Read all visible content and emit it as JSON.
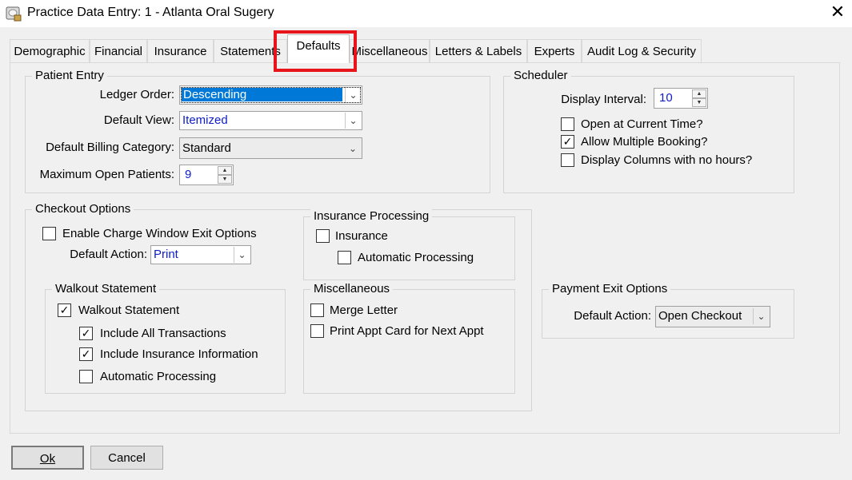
{
  "window": {
    "title": "Practice Data Entry: 1 - Atlanta Oral Sugery",
    "close_glyph": "✕"
  },
  "tabs": [
    {
      "label": "Demographic"
    },
    {
      "label": "Financial"
    },
    {
      "label": "Insurance"
    },
    {
      "label": "Statements"
    },
    {
      "label": "Defaults"
    },
    {
      "label": "Miscellaneous"
    },
    {
      "label": "Letters & Labels"
    },
    {
      "label": "Experts"
    },
    {
      "label": "Audit Log & Security"
    }
  ],
  "active_tab": "Defaults",
  "highlight_color": "#e8141b",
  "patient_entry": {
    "legend": "Patient Entry",
    "ledger_order_label": "Ledger Order:",
    "ledger_order_value": "Descending",
    "default_view_label": "Default View:",
    "default_view_value": "Itemized",
    "billing_category_label": "Default Billing Category:",
    "billing_category_value": "Standard",
    "max_open_label": "Maximum Open Patients:",
    "max_open_value": "9"
  },
  "scheduler": {
    "legend": "Scheduler",
    "display_interval_label": "Display Interval:",
    "display_interval_value": "10",
    "open_current_time": {
      "label": "Open at Current Time?",
      "checked": false
    },
    "allow_multiple": {
      "label": "Allow Multiple Booking?",
      "checked": true
    },
    "display_columns": {
      "label": "Display Columns with no hours?",
      "checked": false
    }
  },
  "checkout": {
    "legend": "Checkout Options",
    "enable_exit": {
      "label": "Enable Charge Window Exit Options",
      "checked": false
    },
    "default_action_label": "Default Action:",
    "default_action_value": "Print",
    "walkout": {
      "legend": "Walkout Statement",
      "walkout_statement": {
        "label": "Walkout Statement",
        "checked": true
      },
      "include_all": {
        "label": "Include All Transactions",
        "checked": true
      },
      "include_insurance": {
        "label": "Include Insurance Information",
        "checked": true
      },
      "automatic": {
        "label": "Automatic Processing",
        "checked": false
      }
    },
    "insurance_processing": {
      "legend": "Insurance Processing",
      "insurance": {
        "label": "Insurance",
        "checked": false
      },
      "automatic": {
        "label": "Automatic Processing",
        "checked": false
      }
    },
    "miscellaneous": {
      "legend": "Miscellaneous",
      "merge_letter": {
        "label": "Merge Letter",
        "checked": false
      },
      "print_appt": {
        "label": "Print Appt Card for Next Appt",
        "checked": false
      }
    }
  },
  "payment_exit": {
    "legend": "Payment Exit Options",
    "default_action_label": "Default Action:",
    "default_action_value": "Open Checkout"
  },
  "buttons": {
    "ok": "Ok",
    "cancel": "Cancel"
  },
  "glyphs": {
    "check": "✓",
    "dropdown": "⌄",
    "up": "▲",
    "down": "▼"
  }
}
